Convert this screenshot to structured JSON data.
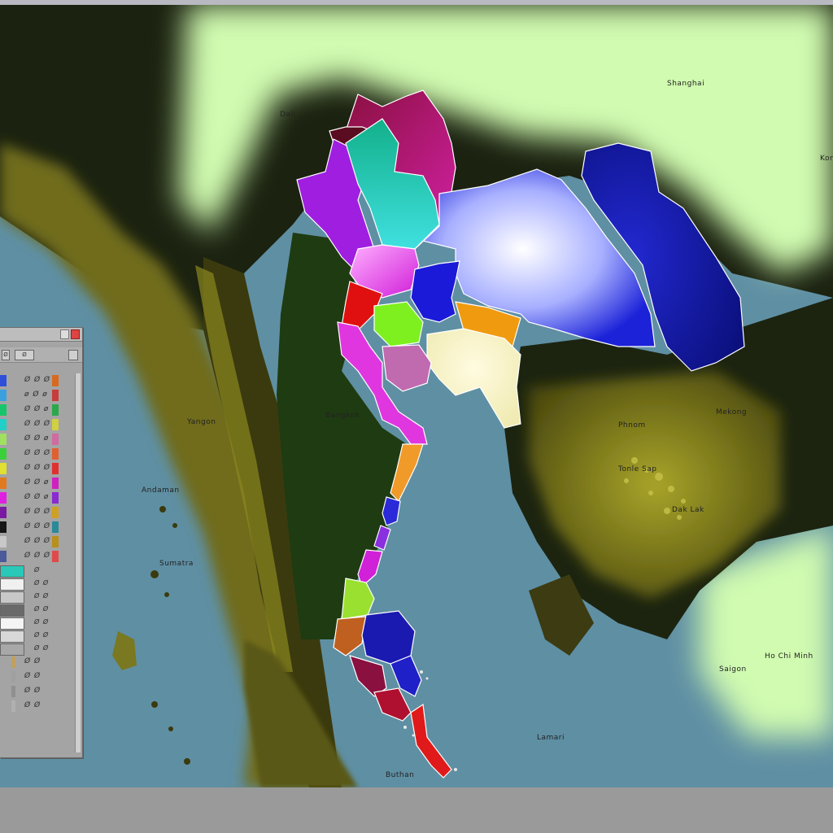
{
  "map": {
    "colors": {
      "sea": "#5f8fa3",
      "lowland_land": "#c8f5a8",
      "dark_land": "#1d2e12",
      "mountain": "#7d7a1e",
      "forest": "#1f3f14"
    },
    "labels": [
      {
        "id": "label-china",
        "text": "Shanghai"
      },
      {
        "id": "label-north",
        "text": "Dali"
      },
      {
        "id": "label-myanmar",
        "text": "Yangon"
      },
      {
        "id": "label-andaman",
        "text": "Andaman"
      },
      {
        "id": "label-bay",
        "text": "Buthan"
      },
      {
        "id": "label-gulf",
        "text": "Bangkok"
      },
      {
        "id": "label-vietnam",
        "text": "Mekong"
      },
      {
        "id": "label-vietnam2",
        "text": "Tonle Sap"
      },
      {
        "id": "label-cambodia",
        "text": "Phnom"
      },
      {
        "id": "label-vn-south",
        "text": "Ho Chi Minh"
      },
      {
        "id": "label-sea",
        "text": "Lamari"
      },
      {
        "id": "label-south",
        "text": "Sumatra"
      },
      {
        "id": "label-hills",
        "text": "Dak Lak"
      },
      {
        "id": "label-east",
        "text": "Kon"
      },
      {
        "id": "label-vn-east",
        "text": "Saigon"
      }
    ]
  },
  "palette": {
    "title": "",
    "swatches": [
      {
        "color": "#2f4fd8",
        "label": "Ø Ø Ø",
        "color2": "#d86a20"
      },
      {
        "color": "#3aa0e0",
        "label": "ø Ø ø",
        "color2": "#c83c3c"
      },
      {
        "color": "#17c66a",
        "label": "Ø Ø ø",
        "color2": "#2aa84a"
      },
      {
        "color": "#1fd0c8",
        "label": "Ø Ø Ø",
        "color2": "#d0d040"
      },
      {
        "color": "#a0e060",
        "label": "Ø Ø ø",
        "color2": "#d06aa0"
      },
      {
        "color": "#3ad03a",
        "label": "Ø Ø Ø",
        "color2": "#e06030"
      },
      {
        "color": "#e0e030",
        "label": "Ø Ø Ø",
        "color2": "#e03030"
      },
      {
        "color": "#e07a20",
        "label": "Ø Ø ø",
        "color2": "#d020c0"
      },
      {
        "color": "#e020e0",
        "label": "Ø Ø ø",
        "color2": "#8a2ad0"
      },
      {
        "color": "#7a1aa0",
        "label": "Ø Ø Ø",
        "color2": "#d0a020"
      },
      {
        "color": "#151515",
        "label": "Ø Ø Ø",
        "color2": "#2a8a9a"
      },
      {
        "color": "#c8c8c8",
        "label": "Ø Ø Ø",
        "color2": "#b8901a"
      },
      {
        "color": "#4a5a9a",
        "label": "Ø Ø Ø",
        "color2": "#e04a4a"
      }
    ],
    "bars": [
      {
        "color": "#2ac8b8",
        "label": "Ø"
      },
      {
        "color": "#f0f0f0",
        "label": "Ø Ø"
      },
      {
        "color": "#c8c8c8",
        "label": "Ø Ø"
      },
      {
        "color": "#6a6a6a",
        "label": "Ø Ø"
      },
      {
        "color": "#f4f4f4",
        "label": "Ø Ø"
      },
      {
        "color": "#d8d8d8",
        "label": "Ø Ø"
      },
      {
        "color": "#a8a8a8",
        "label": "Ø Ø"
      }
    ],
    "small_rows": [
      {
        "color": "#c0a060",
        "label": "Ø Ø"
      },
      {
        "color": "#a0a0a0",
        "label": "Ø Ø"
      },
      {
        "color": "#909090",
        "label": "Ø Ø"
      },
      {
        "color": "#b0b0b0",
        "label": "Ø Ø"
      }
    ],
    "toolbar_label": "Ø"
  }
}
